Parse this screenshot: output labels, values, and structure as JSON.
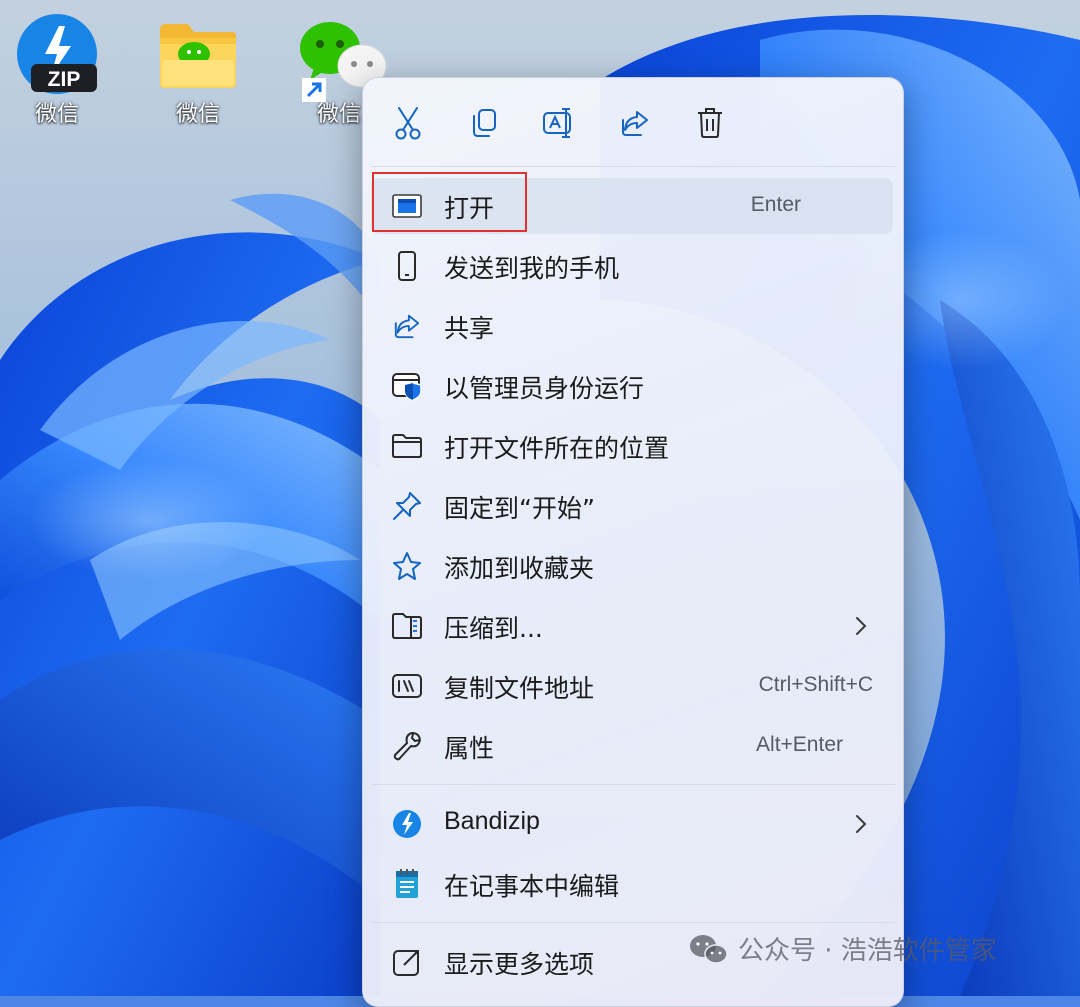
{
  "desktop": {
    "icons": [
      {
        "label": "微信",
        "icon": "bandizip-zip-icon"
      },
      {
        "label": "微信",
        "icon": "folder-wechat-icon"
      },
      {
        "label": "微信",
        "icon": "wechat-shortcut-icon"
      }
    ]
  },
  "context_menu": {
    "toolbar": [
      {
        "name": "cut",
        "icon": "scissors-icon"
      },
      {
        "name": "copy",
        "icon": "copy-icon"
      },
      {
        "name": "rename",
        "icon": "rename-icon"
      },
      {
        "name": "share",
        "icon": "share-icon"
      },
      {
        "name": "delete",
        "icon": "trash-icon"
      }
    ],
    "items": [
      {
        "label": "打开",
        "shortcut": "Enter",
        "icon": "app-window-icon",
        "highlighted": true
      },
      {
        "label": "发送到我的手机",
        "icon": "phone-icon"
      },
      {
        "label": "共享",
        "icon": "share-icon"
      },
      {
        "label": "以管理员身份运行",
        "icon": "admin-shield-icon"
      },
      {
        "label": "打开文件所在的位置",
        "icon": "folder-icon"
      },
      {
        "label": "固定到“开始”",
        "icon": "pin-icon"
      },
      {
        "label": "添加到收藏夹",
        "icon": "star-icon"
      },
      {
        "label": "压缩到...",
        "icon": "zip-folder-icon",
        "submenu": true
      },
      {
        "label": "复制文件地址",
        "shortcut": "Ctrl+Shift+C",
        "icon": "path-copy-icon"
      },
      {
        "label": "属性",
        "shortcut": "Alt+Enter",
        "icon": "wrench-icon"
      },
      {
        "label": "Bandizip",
        "icon": "bandizip-icon",
        "submenu": true
      },
      {
        "label": "在记事本中编辑",
        "icon": "notepad-icon"
      },
      {
        "label": "显示更多选项",
        "icon": "show-more-icon"
      }
    ]
  },
  "watermark": {
    "text": "公众号 · 浩浩软件管家",
    "icon": "wechat-logo-icon"
  },
  "colors": {
    "accent": "#1a73e8",
    "highlight_outline": "#e0322f",
    "wechat_green": "#2dc100"
  }
}
